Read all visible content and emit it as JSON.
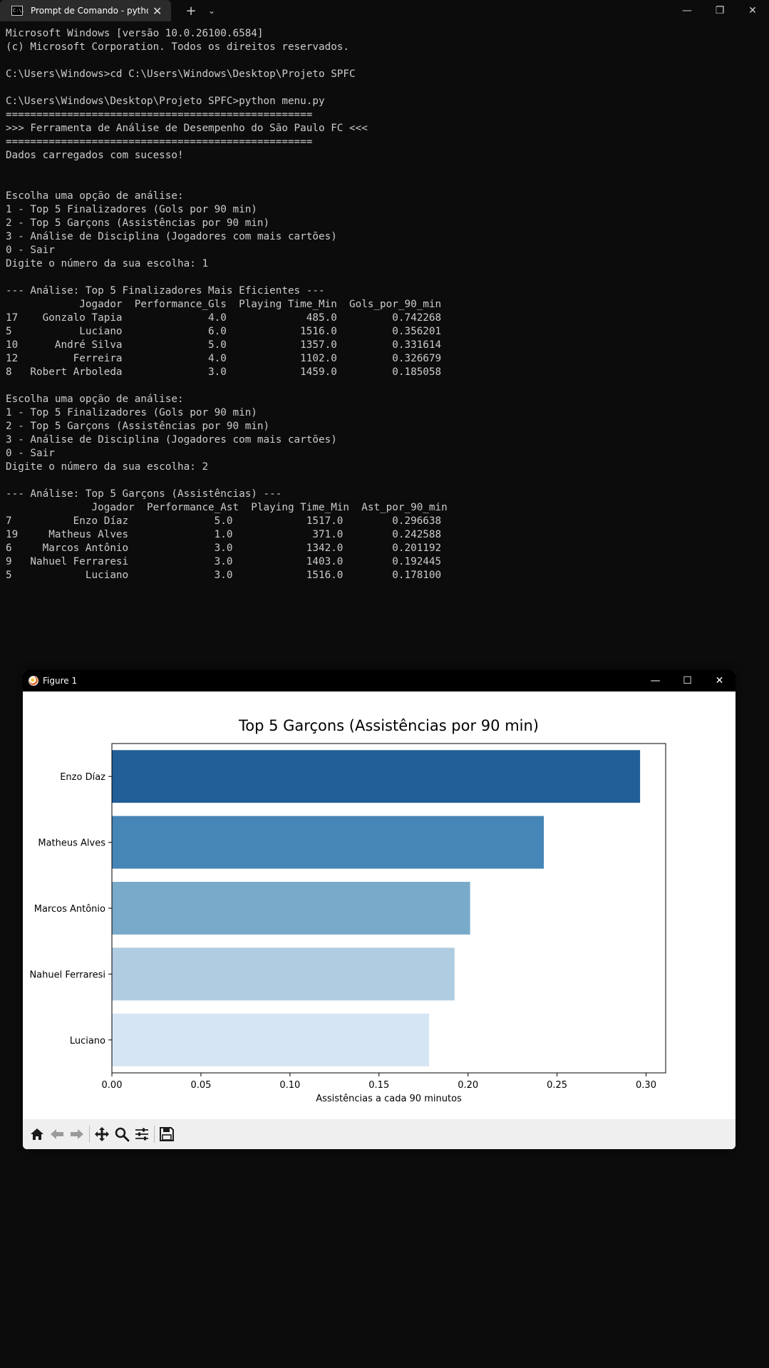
{
  "terminal_window": {
    "tab_title": "Prompt de Comando - python",
    "new_tab_symbol": "+",
    "dropdown_symbol": "⌄",
    "tab_icon_text": "C:\\.",
    "close_symbol": "✕",
    "minimize_symbol": "—",
    "restore_symbol": "❐",
    "lines": [
      "Microsoft Windows [versão 10.0.26100.6584]",
      "(c) Microsoft Corporation. Todos os direitos reservados.",
      "",
      "C:\\Users\\Windows>cd C:\\Users\\Windows\\Desktop\\Projeto SPFC",
      "",
      "C:\\Users\\Windows\\Desktop\\Projeto SPFC>python menu.py",
      "==================================================",
      ">>> Ferramenta de Análise de Desempenho do São Paulo FC <<<",
      "==================================================",
      "Dados carregados com sucesso!",
      "",
      "",
      "Escolha uma opção de análise:",
      "1 - Top 5 Finalizadores (Gols por 90 min)",
      "2 - Top 5 Garçons (Assistências por 90 min)",
      "3 - Análise de Disciplina (Jogadores com mais cartões)",
      "0 - Sair",
      "Digite o número da sua escolha: 1",
      "",
      "--- Análise: Top 5 Finalizadores Mais Eficientes ---",
      "            Jogador  Performance_Gls  Playing Time_Min  Gols_por_90_min",
      "17    Gonzalo Tapia              4.0             485.0         0.742268",
      "5           Luciano              6.0            1516.0         0.356201",
      "10      André Silva              5.0            1357.0         0.331614",
      "12         Ferreira              4.0            1102.0         0.326679",
      "8   Robert Arboleda              3.0            1459.0         0.185058",
      "",
      "Escolha uma opção de análise:",
      "1 - Top 5 Finalizadores (Gols por 90 min)",
      "2 - Top 5 Garçons (Assistências por 90 min)",
      "3 - Análise de Disciplina (Jogadores com mais cartões)",
      "0 - Sair",
      "Digite o número da sua escolha: 2",
      "",
      "--- Análise: Top 5 Garçons (Assistências) ---",
      "              Jogador  Performance_Ast  Playing Time_Min  Ast_por_90_min",
      "7          Enzo Díaz              5.0            1517.0        0.296638",
      "19     Matheus Alves              1.0             371.0        0.242588",
      "6     Marcos Antônio              3.0            1342.0        0.201192",
      "9   Nahuel Ferraresi              3.0            1403.0        0.192445",
      "5            Luciano              3.0            1516.0        0.178100"
    ]
  },
  "figure_window": {
    "title": "Figure 1",
    "minimize_symbol": "—",
    "maximize_symbol": "☐",
    "close_symbol": "✕",
    "toolbar": [
      "home-icon",
      "back-icon",
      "forward-icon",
      "pan-icon",
      "zoom-icon",
      "configure-subplots-icon",
      "save-icon"
    ]
  },
  "chart_data": {
    "type": "bar",
    "orientation": "horizontal",
    "title": "Top 5 Garçons (Assistências por 90 min)",
    "xlabel": "Assistências a cada 90 minutos",
    "ylabel": "",
    "categories": [
      "Enzo Díaz",
      "Matheus Alves",
      "Marcos Antônio",
      "Nahuel Ferraresi",
      "Luciano"
    ],
    "values": [
      0.296638,
      0.242588,
      0.201192,
      0.192445,
      0.1781
    ],
    "colors": [
      "#225e97",
      "#4686b6",
      "#7aaaca",
      "#b0cce1",
      "#d6e5f3"
    ],
    "xlim": [
      0,
      0.311
    ],
    "xticks": [
      "0.00",
      "0.05",
      "0.10",
      "0.15",
      "0.20",
      "0.25",
      "0.30"
    ],
    "xtick_values": [
      0,
      0.05,
      0.1,
      0.15,
      0.2,
      0.25,
      0.3
    ],
    "grid": false
  }
}
